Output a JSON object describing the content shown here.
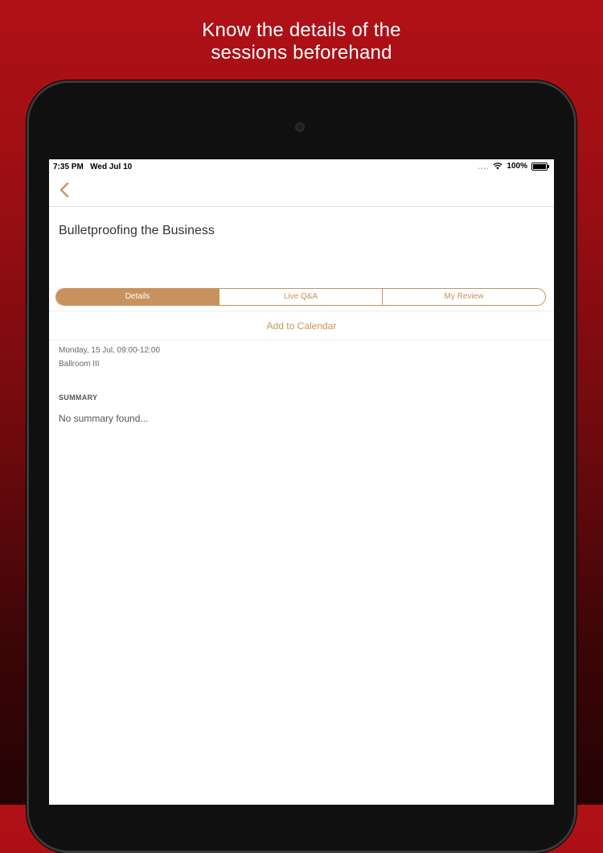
{
  "promo": {
    "line1": "Know the details of the",
    "line2": "sessions beforehand"
  },
  "status_bar": {
    "time": "7:35 PM",
    "date": "Wed Jul 10",
    "signal_dots": "....",
    "battery": "100%"
  },
  "nav": {
    "back_icon": "chevron-left-icon"
  },
  "session": {
    "title": "Bulletproofing the Business",
    "tabs": [
      {
        "label": "Details",
        "active": true
      },
      {
        "label": "Live Q&A",
        "active": false
      },
      {
        "label": "My Review",
        "active": false
      }
    ],
    "add_to_calendar": "Add to Calendar",
    "datetime": "Monday, 15 Jul, 09:00-12:00",
    "location": "Ballroom III",
    "summary_header": "SUMMARY",
    "summary_text": "No summary found..."
  },
  "colors": {
    "accent": "#c8925e",
    "background_top": "#b01116",
    "background_bottom": "#240304"
  }
}
